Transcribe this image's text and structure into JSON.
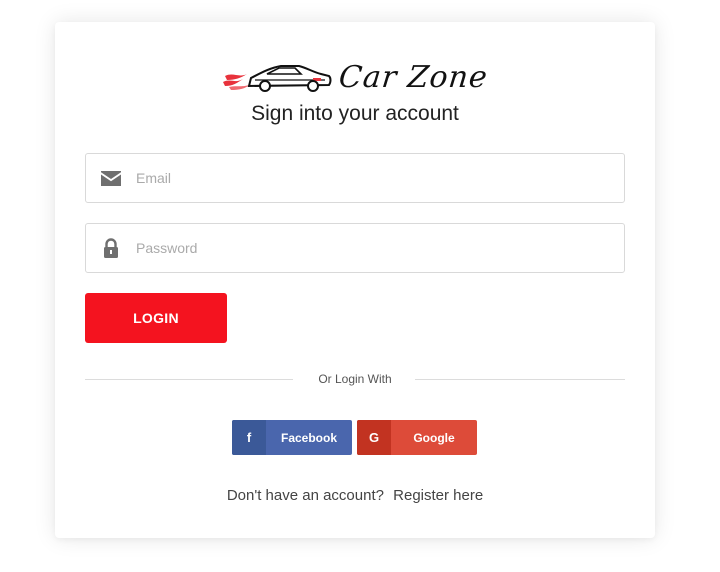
{
  "brand": {
    "name": "Car Zone",
    "logo_icon": "car-flame-icon",
    "accent": "#f4131f"
  },
  "heading": "Sign into your account",
  "email": {
    "placeholder": "Email",
    "value": "",
    "icon": "envelope-icon"
  },
  "password": {
    "placeholder": "Password",
    "value": "",
    "icon": "lock-icon"
  },
  "login_button": {
    "label": "LOGIN",
    "color": "#f4131f"
  },
  "divider_text": "Or Login With",
  "social": {
    "facebook": {
      "icon_glyph": "f",
      "label": "Facebook",
      "color": "#4a66ad"
    },
    "google": {
      "icon_glyph": "G",
      "label": "Google",
      "color": "#dd4b39"
    }
  },
  "register": {
    "prompt": "Don't have an account?",
    "link": "Register here"
  }
}
